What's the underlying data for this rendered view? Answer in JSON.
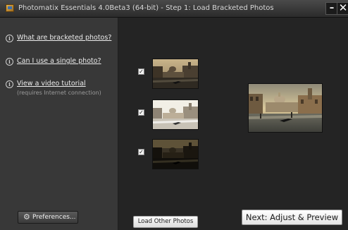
{
  "window": {
    "title": "Photomatix Essentials  4.0Beta3 (64-bit) - Step 1: Load Bracketed Photos",
    "minimize_glyph": "–",
    "close_glyph": "✕"
  },
  "sidebar": {
    "help_items": [
      {
        "label": "What are bracketed photos?",
        "icon": "info-icon"
      },
      {
        "label": "Can I use a single photo?",
        "icon": "info-icon"
      },
      {
        "label": "View a video tutorial",
        "sublabel": "(requires Internet connection)",
        "icon": "info-icon"
      }
    ],
    "info_glyph": "i",
    "preferences_label": "Preferences...",
    "preferences_icon": "gear-icon"
  },
  "main": {
    "photos": [
      {
        "checked": true,
        "exposure": "normal",
        "check_glyph": "✓"
      },
      {
        "checked": true,
        "exposure": "bright",
        "check_glyph": "✓"
      },
      {
        "checked": true,
        "exposure": "dark",
        "check_glyph": "✓"
      }
    ],
    "preview_exposure": "hdr",
    "load_other_label": "Load Other Photos",
    "next_label": "Next: Adjust & Preview"
  },
  "colors": {
    "window_bg": "#252525",
    "sidebar_bg": "#383838",
    "titlebar_bg": "#2b2b2b"
  }
}
